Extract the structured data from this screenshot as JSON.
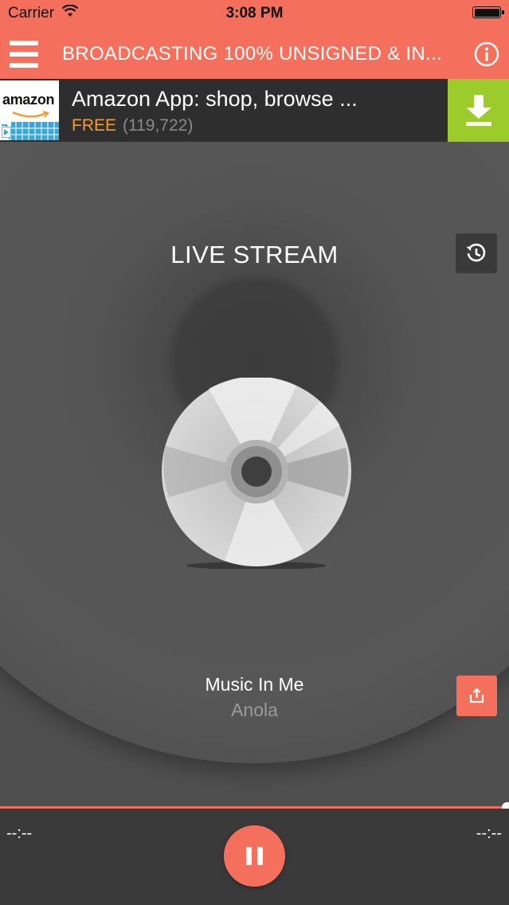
{
  "status_bar": {
    "carrier": "Carrier",
    "time": "3:08 PM"
  },
  "nav": {
    "title": "BROADCASTING 100% UNSIGNED & IN...",
    "menu_icon": "hamburger-menu-icon",
    "info_icon": "info-icon"
  },
  "ad": {
    "logo_text": "amazon",
    "title": "Amazon App: shop, browse ...",
    "price": "FREE",
    "rating_count": "(119,722)",
    "download_icon": "download-icon"
  },
  "player": {
    "stream_title": "LIVE STREAM",
    "history_icon": "history-icon",
    "artwork_icon": "cd-icon",
    "song_title": "Music In Me",
    "artist": "Anola",
    "share_icon": "share-icon"
  },
  "controls": {
    "elapsed": "--:--",
    "remaining": "--:--",
    "progress": 1.0,
    "pause_icon": "pause-icon"
  },
  "colors": {
    "accent": "#f4705c",
    "ad_download": "#9ccc2b",
    "ad_free": "#f39c32",
    "background": "#4f4f4f",
    "controls_bg": "#3a3a3a"
  }
}
